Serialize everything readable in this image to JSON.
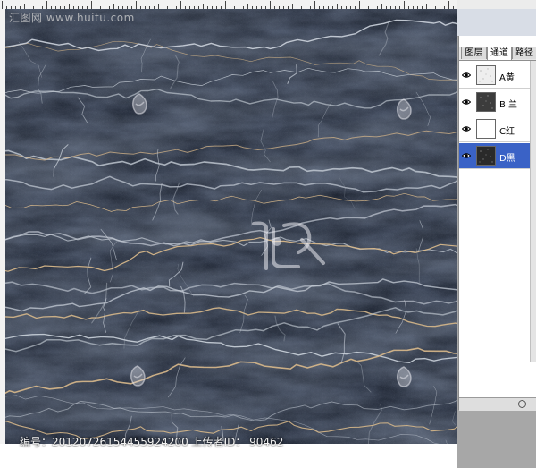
{
  "watermark": {
    "site": "汇图网 www.huitu.com"
  },
  "caption": {
    "id_label": "编号",
    "id_value": "20120726154455924200",
    "uploader_label": "上传者ID",
    "uploader_value": "90462"
  },
  "panel": {
    "tabs": [
      {
        "label": "图层",
        "active": false
      },
      {
        "label": "通道",
        "active": true
      },
      {
        "label": "路径",
        "active": false
      }
    ],
    "channels": [
      {
        "name": "A黄",
        "selected": false,
        "thumb": "speckle-light"
      },
      {
        "name": "B 兰",
        "selected": false,
        "thumb": "speckle-dark"
      },
      {
        "name": "C红",
        "selected": false,
        "thumb": "white"
      },
      {
        "name": "D黑",
        "selected": true,
        "thumb": "speckle-dark"
      }
    ]
  },
  "colors": {
    "marble_base": "#141a26",
    "vein_light": "#c8cfd8",
    "vein_gold": "#d9b98a",
    "selection": "#3a62c6"
  }
}
